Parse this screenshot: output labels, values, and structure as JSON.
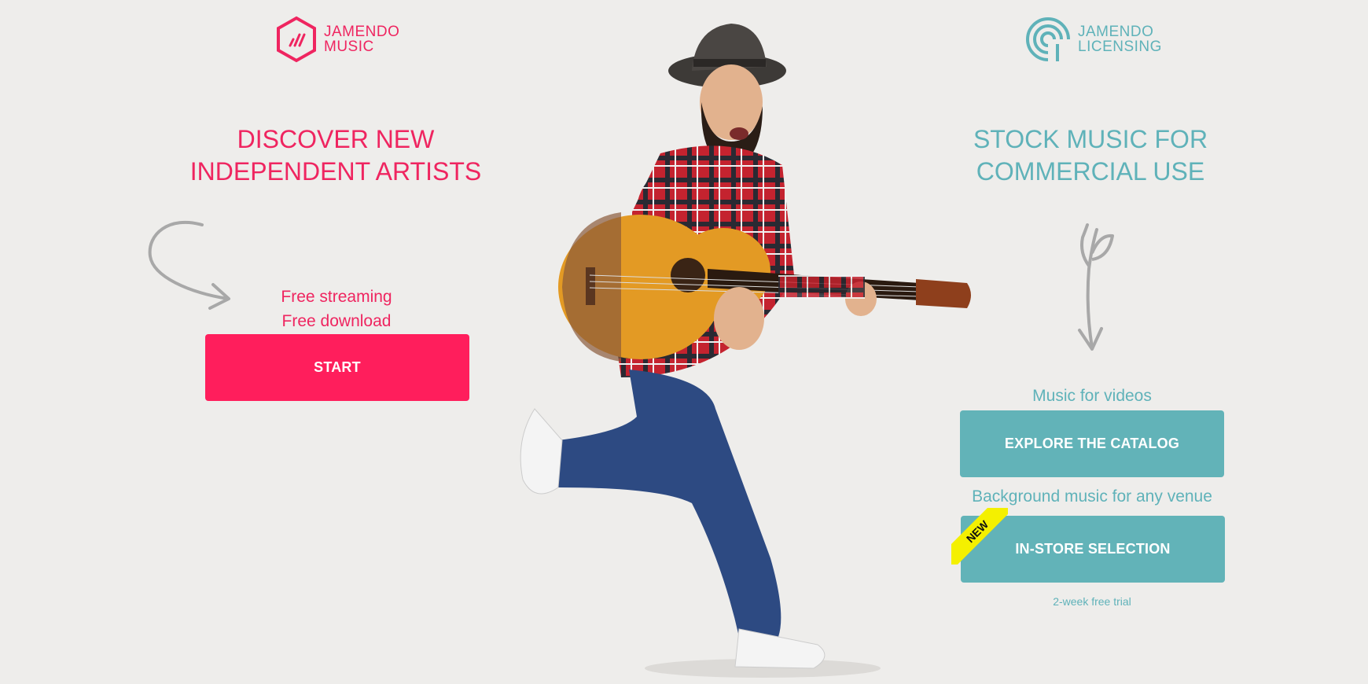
{
  "music": {
    "logo_line1": "JAMENDO",
    "logo_line2": "MUSIC",
    "headline_line1": "DISCOVER NEW",
    "headline_line2": "INDEPENDENT ARTISTS",
    "sub_line1": "Free streaming",
    "sub_line2": "Free download",
    "start_label": "START"
  },
  "licensing": {
    "logo_line1": "JAMENDO",
    "logo_line2": "LICENSING",
    "headline_line1": "STOCK MUSIC FOR",
    "headline_line2": "COMMERCIAL USE",
    "videos_text": "Music for videos",
    "catalog_label": "EXPLORE THE CATALOG",
    "venue_text": "Background music for any venue",
    "instore_label": "IN-STORE SELECTION",
    "new_badge": "NEW",
    "trial_text": "2-week free trial"
  },
  "colors": {
    "music_accent": "#ef2560",
    "licensing_accent": "#5fb2b9",
    "background": "#eeedeb"
  },
  "icons": [
    "jamendo-music-logo-icon",
    "jamendo-licensing-logo-icon",
    "curved-arrow-icon",
    "leaf-arrow-icon"
  ]
}
